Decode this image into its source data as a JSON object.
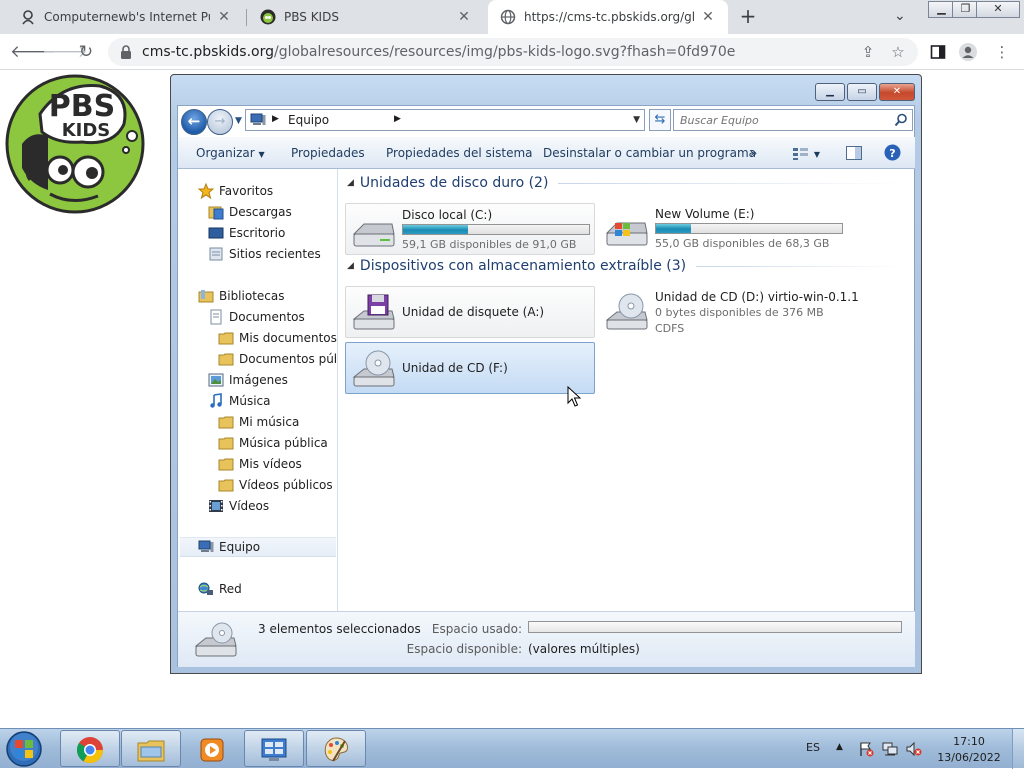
{
  "browser": {
    "tabs": [
      {
        "title": "Computernewb's Internet Pub Hub"
      },
      {
        "title": "PBS KIDS"
      },
      {
        "title": "https://cms-tc.pbskids.org/globalresources"
      }
    ],
    "new_tab": "+",
    "tab_list": "⌄",
    "url_host": "cms-tc.pbskids.org",
    "url_path": "/globalresources/resources/img/pbs-kids-logo.svg?fhash=0fd970e"
  },
  "page": {
    "logo_line1": "PBS",
    "logo_line2": "KIDS"
  },
  "explorer": {
    "address": {
      "root_label": "Equipo",
      "search_placeholder": "Buscar Equipo"
    },
    "commands": {
      "organize": "Organizar",
      "properties": "Propiedades",
      "system_properties": "Propiedades del sistema",
      "uninstall": "Desinstalar o cambiar un programa",
      "more": "»"
    },
    "nav": {
      "favorites": "Favoritos",
      "downloads": "Descargas",
      "desktop": "Escritorio",
      "recent": "Sitios recientes",
      "libraries": "Bibliotecas",
      "documents": "Documentos",
      "my_documents": "Mis documentos",
      "public_documents": "Documentos públicos",
      "images": "Imágenes",
      "music": "Música",
      "my_music": "Mi música",
      "public_music": "Música pública",
      "my_videos": "Mis vídeos",
      "public_videos": "Vídeos públicos",
      "videos": "Vídeos",
      "computer": "Equipo",
      "network": "Red"
    },
    "groups": {
      "hdd": "Unidades de disco duro (2)",
      "removable": "Dispositivos con almacenamiento extraíble (3)"
    },
    "drives": {
      "c": {
        "name": "Disco local (C:)",
        "free": "59,1 GB disponibles de 91,0 GB",
        "used_fraction": 0.35
      },
      "e": {
        "name": "New Volume (E:)",
        "free": "55,0 GB disponibles de 68,3 GB",
        "used_fraction": 0.19
      },
      "a": {
        "name": "Unidad de disquete (A:)"
      },
      "d": {
        "name": "Unidad de CD (D:) virtio-win-0.1.1",
        "free": "0 bytes disponibles de 376 MB",
        "fs": "CDFS"
      },
      "f": {
        "name": "Unidad de CD (F:)"
      }
    },
    "details": {
      "selected": "3 elementos seleccionados",
      "used_label": "Espacio usado:",
      "free_label": "Espacio disponible:",
      "free_value": "(valores múltiples)"
    }
  },
  "taskbar": {
    "lang": "ES",
    "time": "17:10",
    "date": "13/06/2022"
  },
  "colors": {
    "selection": "#cce8ff",
    "explorer_frame": "#b4cbe6",
    "drive_bar": "#1a8bb3"
  }
}
